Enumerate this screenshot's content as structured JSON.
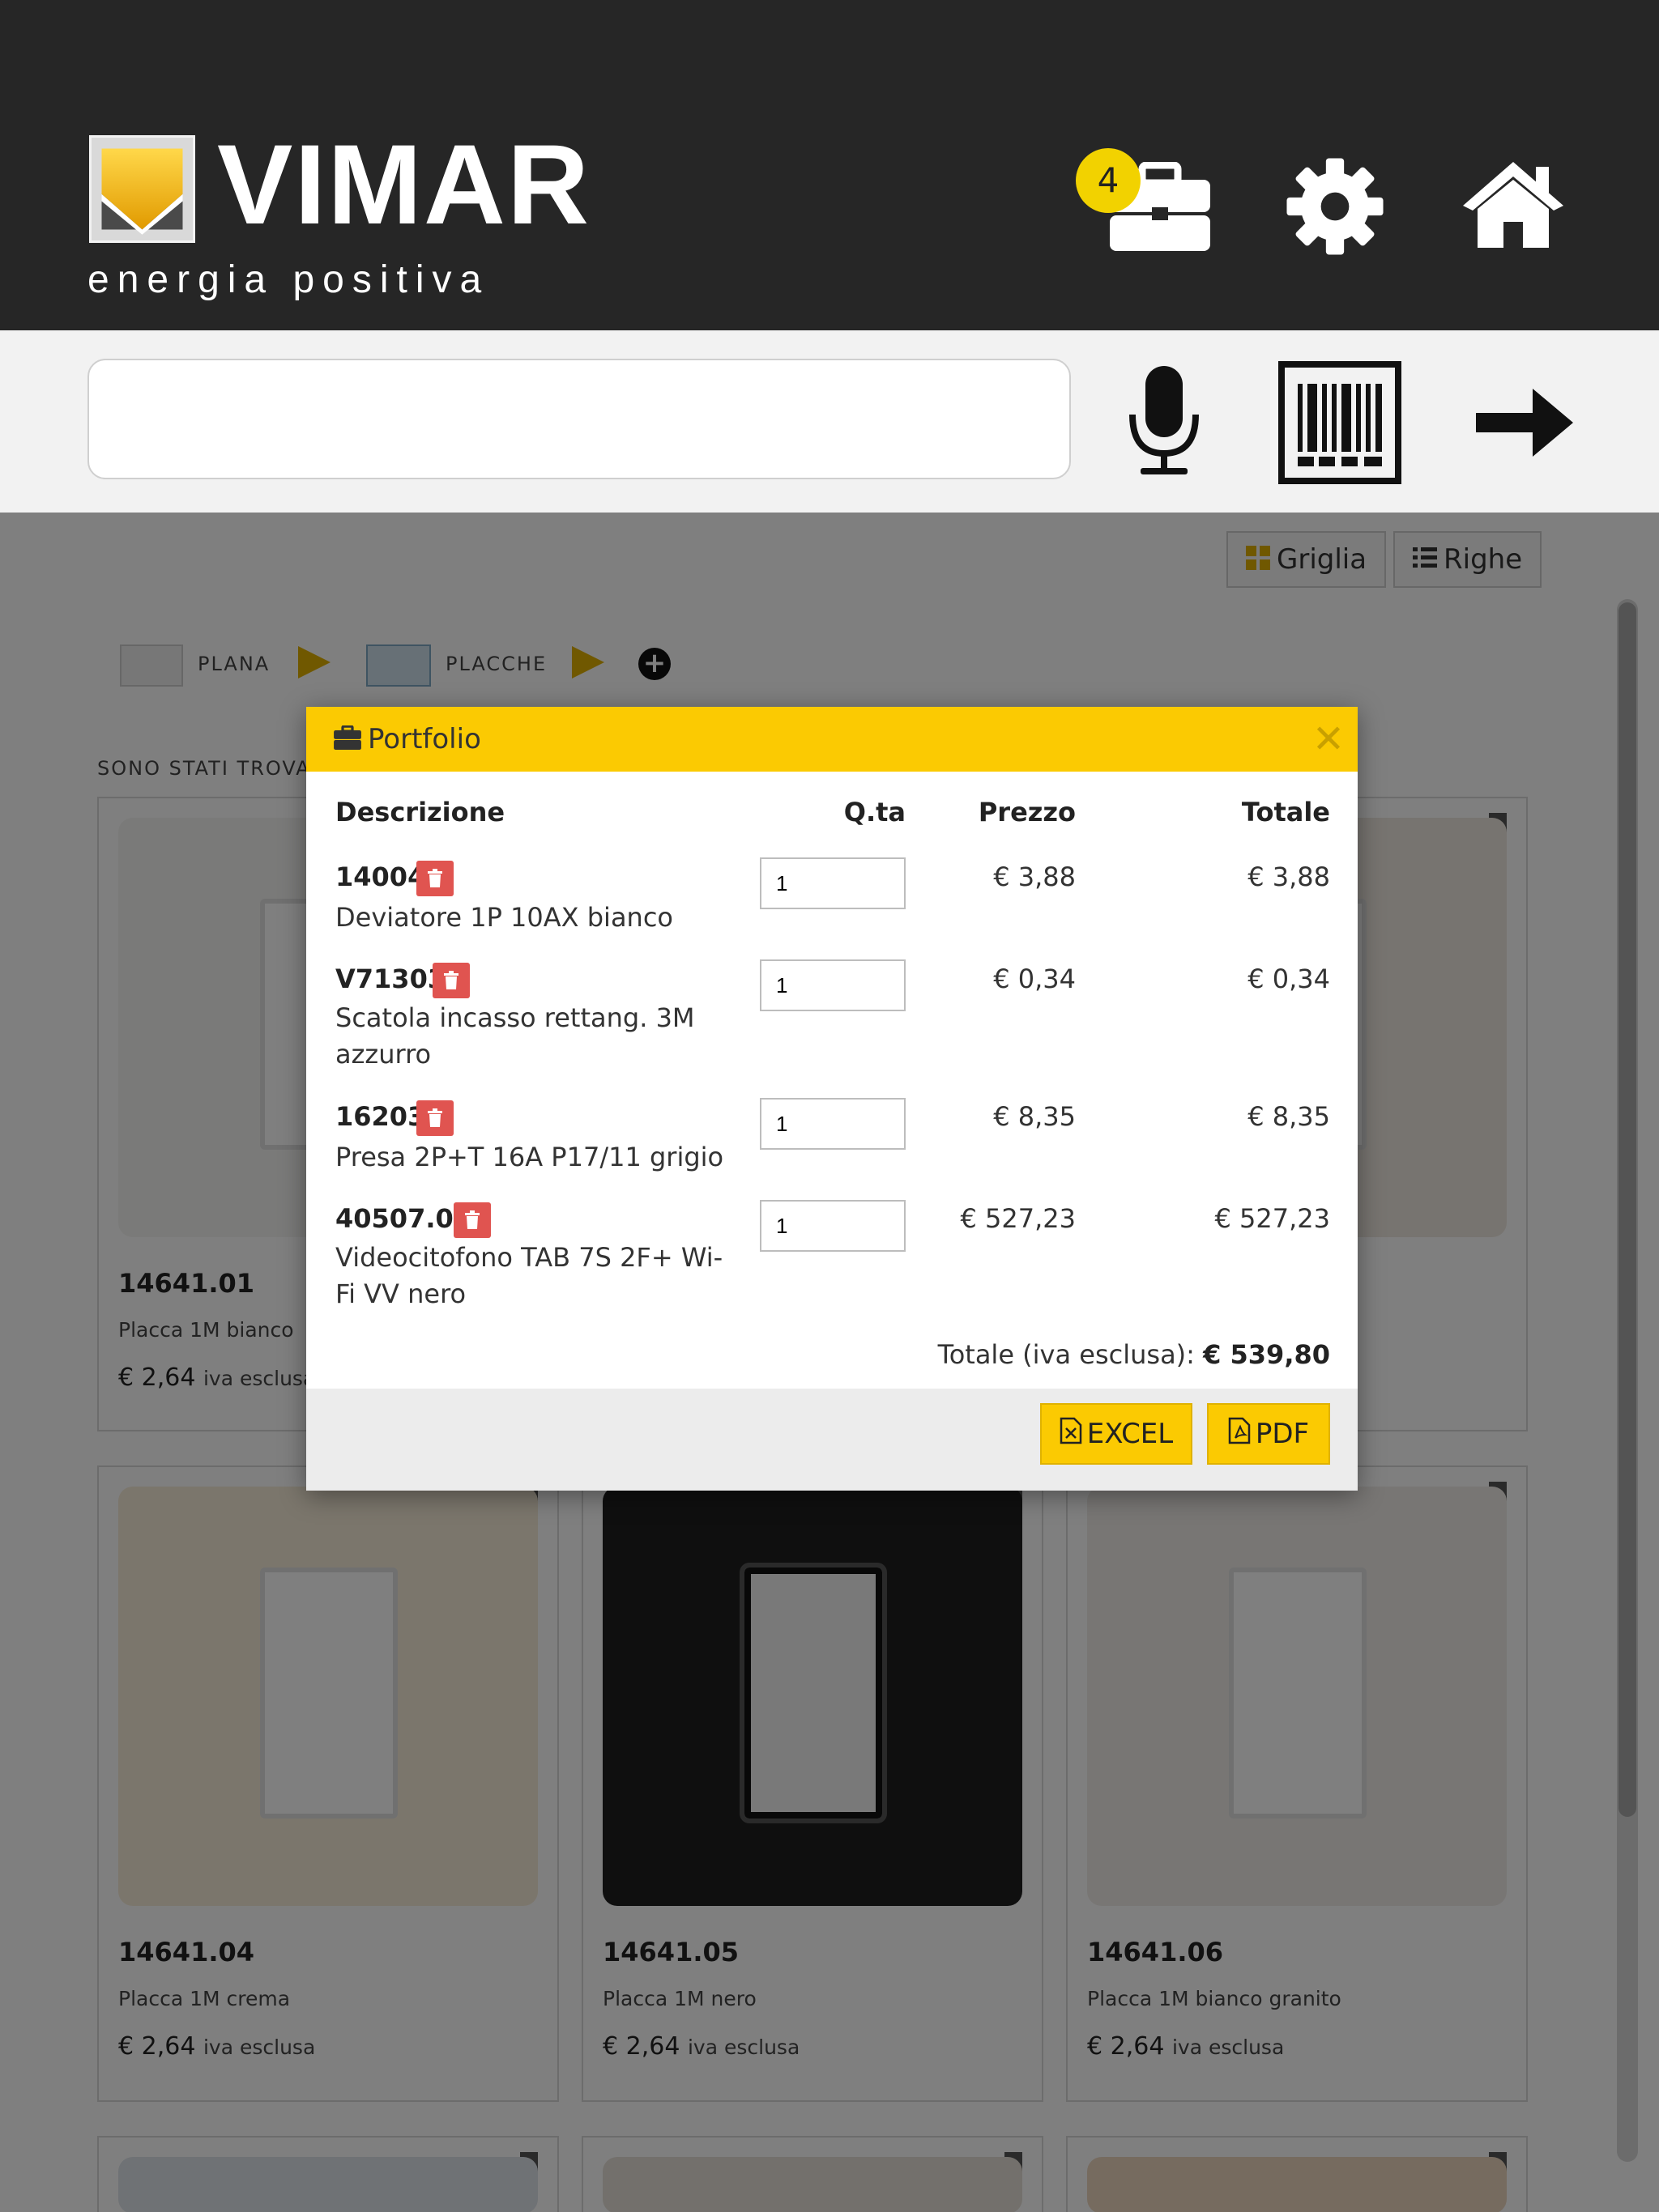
{
  "header": {
    "brand": "VIMAR",
    "tagline": "energia positiva",
    "portfolio_count": "4",
    "icons": [
      "briefcase-icon",
      "gear-icon",
      "home-icon"
    ]
  },
  "search": {
    "value": "",
    "placeholder": "",
    "icons": [
      "microphone-icon",
      "barcode-icon",
      "arrow-right-icon"
    ]
  },
  "toolbar": {
    "grid_label": "Griglia",
    "rows_label": "Righe"
  },
  "breadcrumb": {
    "items": [
      "PLANA",
      "PLACCHE"
    ]
  },
  "results": {
    "found_text": "SONO STATI TROVATI"
  },
  "products": [
    {
      "code": "14641.01",
      "desc": "Placca 1M bianco",
      "price": "€ 2,64",
      "vat": "iva esclusa",
      "color": "#f4f4f2"
    },
    {
      "code": "",
      "desc": "",
      "price": "",
      "vat": "",
      "color": "#f4f4f2"
    },
    {
      "code": "",
      "desc": "",
      "price": "",
      "vat": "",
      "color": "#efe9e0"
    },
    {
      "code": "14641.04",
      "desc": "Placca 1M crema",
      "price": "€ 2,64",
      "vat": "iva esclusa",
      "color": "#f6edd8"
    },
    {
      "code": "14641.05",
      "desc": "Placca 1M nero",
      "price": "€ 2,64",
      "vat": "iva esclusa",
      "color": "#1e1e1e"
    },
    {
      "code": "14641.06",
      "desc": "Placca 1M bianco granito",
      "price": "€ 2,64",
      "vat": "iva esclusa",
      "color": "#f0ede8"
    }
  ],
  "modal": {
    "title": "Portfolio",
    "columns": {
      "desc": "Descrizione",
      "qty": "Q.ta",
      "price": "Prezzo",
      "total": "Totale"
    },
    "rows": [
      {
        "code": "14004",
        "desc": "Deviatore 1P 10AX bianco",
        "qty": "1",
        "price": "€ 3,88",
        "total": "€ 3,88"
      },
      {
        "code": "V71303",
        "desc": "Scatola incasso rettang. 3M azzurro",
        "qty": "1",
        "price": "€ 0,34",
        "total": "€ 0,34"
      },
      {
        "code": "16203",
        "desc": "Presa 2P+T 16A P17/11 grigio",
        "qty": "1",
        "price": "€ 8,35",
        "total": "€ 8,35"
      },
      {
        "code": "40507.04",
        "desc": "Videocitofono TAB 7S 2F+ Wi-Fi VV nero",
        "qty": "1",
        "price": "€ 527,23",
        "total": "€ 527,23"
      }
    ],
    "grand_label": "Totale (iva esclusa):",
    "grand_value": "€ 539,80",
    "excel_label": "EXCEL",
    "pdf_label": "PDF"
  },
  "colors": {
    "header_bg": "#262626",
    "accent_yellow": "#fbca02",
    "delete_red": "#e05450"
  }
}
